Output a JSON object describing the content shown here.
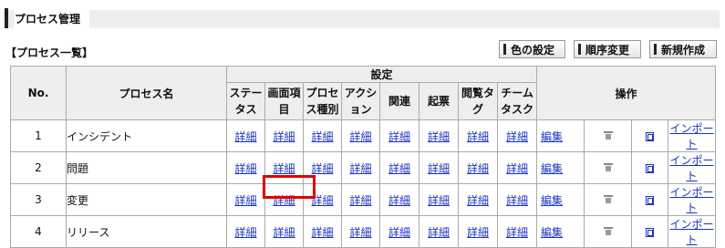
{
  "header": {
    "title": "プロセス管理"
  },
  "list_title": "【プロセス一覧】",
  "toolbar": {
    "color_label": "色の設定",
    "order_label": "順序変更",
    "new_label": "新規作成"
  },
  "table": {
    "col_no": "No.",
    "col_name": "プロセス名",
    "group_settings": "設定",
    "col_ops": "操作",
    "settings_columns": [
      "ステータス",
      "画面項目",
      "プロセス種別",
      "アクション",
      "関連",
      "起票",
      "閲覧タグ",
      "チームタスク"
    ],
    "detail_label": "詳細",
    "edit_label": "編集",
    "import_label": "インポート",
    "rows": [
      {
        "no": "1",
        "name": "インシデント"
      },
      {
        "no": "2",
        "name": "問題"
      },
      {
        "no": "3",
        "name": "変更"
      },
      {
        "no": "4",
        "name": "リリース"
      }
    ]
  }
}
